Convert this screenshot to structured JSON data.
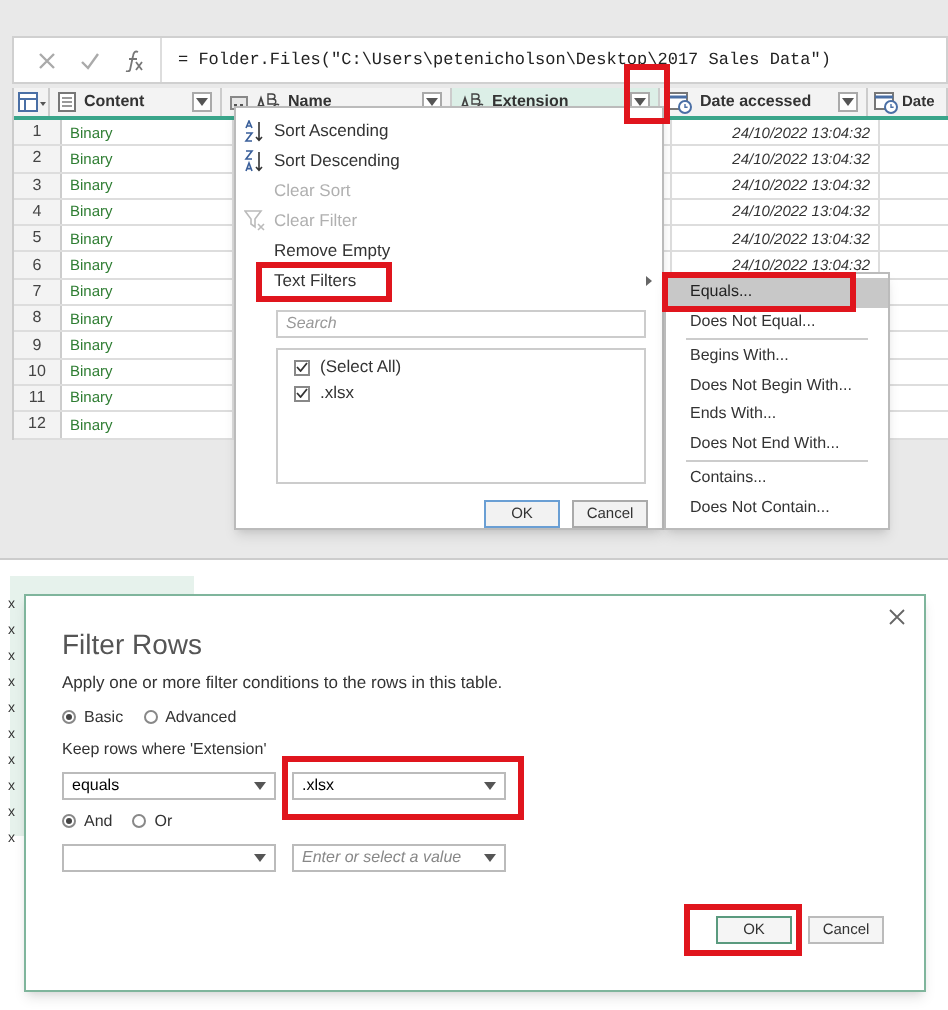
{
  "formula_bar": {
    "formula": "= Folder.Files(\"C:\\Users\\petenicholson\\Desktop\\2017 Sales Data\")"
  },
  "columns": [
    {
      "label": "Content",
      "kind": "binary"
    },
    {
      "label": "Name",
      "kind": "text"
    },
    {
      "label": "Extension",
      "kind": "text"
    },
    {
      "label": "Date accessed",
      "kind": "date"
    },
    {
      "label": "Date",
      "kind": "date"
    }
  ],
  "rows": [
    {
      "index": "1",
      "content": "Binary",
      "date_accessed": "24/10/2022 13:04:32"
    },
    {
      "index": "2",
      "content": "Binary",
      "date_accessed": "24/10/2022 13:04:32"
    },
    {
      "index": "3",
      "content": "Binary",
      "date_accessed": "24/10/2022 13:04:32"
    },
    {
      "index": "4",
      "content": "Binary",
      "date_accessed": "24/10/2022 13:04:32"
    },
    {
      "index": "5",
      "content": "Binary",
      "date_accessed": "24/10/2022 13:04:32"
    },
    {
      "index": "6",
      "content": "Binary",
      "date_accessed": "24/10/2022 13:04:32"
    },
    {
      "index": "7",
      "content": "Binary"
    },
    {
      "index": "8",
      "content": "Binary"
    },
    {
      "index": "9",
      "content": "Binary"
    },
    {
      "index": "10",
      "content": "Binary"
    },
    {
      "index": "11",
      "content": "Binary"
    },
    {
      "index": "12",
      "content": "Binary"
    }
  ],
  "filter_menu": {
    "items": [
      {
        "label": "Sort Ascending",
        "kind": "sort_asc",
        "disabled": false
      },
      {
        "label": "Sort Descending",
        "kind": "sort_desc",
        "disabled": false
      },
      {
        "label": "Clear Sort",
        "kind": "plain",
        "disabled": true
      },
      {
        "label": "Clear Filter",
        "kind": "clear_filter",
        "disabled": true
      },
      {
        "label": "Remove Empty",
        "kind": "plain",
        "disabled": false
      },
      {
        "label": "Text Filters",
        "kind": "submenu",
        "disabled": false
      }
    ],
    "search": {
      "placeholder": "Search"
    },
    "values": [
      {
        "label": "(Select All)",
        "checked": true
      },
      {
        "label": ".xlsx",
        "checked": true
      }
    ],
    "buttons": [
      "OK",
      "Cancel"
    ]
  },
  "text_filters_menu": [
    {
      "label": "Equals...",
      "selected": true,
      "separator_before": false
    },
    {
      "label": "Does Not Equal...",
      "selected": false,
      "separator_before": false
    },
    {
      "label": "Begins With...",
      "selected": false,
      "separator_before": true
    },
    {
      "label": "Does Not Begin With...",
      "selected": false,
      "separator_before": false
    },
    {
      "label": "Ends With...",
      "selected": false,
      "separator_before": false
    },
    {
      "label": "Does Not End With...",
      "selected": false,
      "separator_before": false
    },
    {
      "label": "Contains...",
      "selected": false,
      "separator_before": true
    },
    {
      "label": "Does Not Contain...",
      "selected": false,
      "separator_before": false
    }
  ],
  "background_cells": [
    "x",
    "x",
    "x",
    "x",
    "x",
    "x",
    "x",
    "x",
    "x",
    "x"
  ],
  "dialog": {
    "title": "Filter Rows",
    "description": "Apply one or more filter conditions to the rows in this table.",
    "modes": [
      {
        "label": "Basic",
        "selected": true
      },
      {
        "label": "Advanced",
        "selected": false
      }
    ],
    "keep_label": "Keep rows where 'Extension'",
    "condition_1": {
      "operator": "equals",
      "value": ".xlsx"
    },
    "joins": [
      {
        "label": "And",
        "selected": true
      },
      {
        "label": "Or",
        "selected": false
      }
    ],
    "condition_2": {
      "value_placeholder": "Enter or select a value"
    },
    "buttons": [
      "OK",
      "Cancel"
    ]
  }
}
